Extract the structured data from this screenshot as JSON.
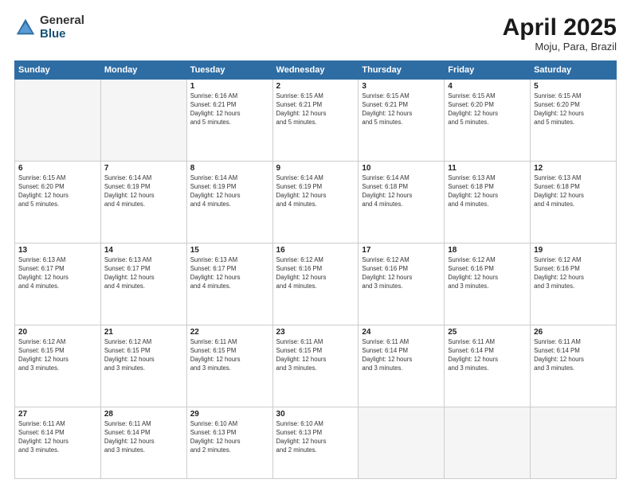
{
  "header": {
    "logo_general": "General",
    "logo_blue": "Blue",
    "title": "April 2025",
    "location": "Moju, Para, Brazil"
  },
  "days_of_week": [
    "Sunday",
    "Monday",
    "Tuesday",
    "Wednesday",
    "Thursday",
    "Friday",
    "Saturday"
  ],
  "weeks": [
    [
      {
        "num": "",
        "info": ""
      },
      {
        "num": "",
        "info": ""
      },
      {
        "num": "1",
        "info": "Sunrise: 6:16 AM\nSunset: 6:21 PM\nDaylight: 12 hours\nand 5 minutes."
      },
      {
        "num": "2",
        "info": "Sunrise: 6:15 AM\nSunset: 6:21 PM\nDaylight: 12 hours\nand 5 minutes."
      },
      {
        "num": "3",
        "info": "Sunrise: 6:15 AM\nSunset: 6:21 PM\nDaylight: 12 hours\nand 5 minutes."
      },
      {
        "num": "4",
        "info": "Sunrise: 6:15 AM\nSunset: 6:20 PM\nDaylight: 12 hours\nand 5 minutes."
      },
      {
        "num": "5",
        "info": "Sunrise: 6:15 AM\nSunset: 6:20 PM\nDaylight: 12 hours\nand 5 minutes."
      }
    ],
    [
      {
        "num": "6",
        "info": "Sunrise: 6:15 AM\nSunset: 6:20 PM\nDaylight: 12 hours\nand 5 minutes."
      },
      {
        "num": "7",
        "info": "Sunrise: 6:14 AM\nSunset: 6:19 PM\nDaylight: 12 hours\nand 4 minutes."
      },
      {
        "num": "8",
        "info": "Sunrise: 6:14 AM\nSunset: 6:19 PM\nDaylight: 12 hours\nand 4 minutes."
      },
      {
        "num": "9",
        "info": "Sunrise: 6:14 AM\nSunset: 6:19 PM\nDaylight: 12 hours\nand 4 minutes."
      },
      {
        "num": "10",
        "info": "Sunrise: 6:14 AM\nSunset: 6:18 PM\nDaylight: 12 hours\nand 4 minutes."
      },
      {
        "num": "11",
        "info": "Sunrise: 6:13 AM\nSunset: 6:18 PM\nDaylight: 12 hours\nand 4 minutes."
      },
      {
        "num": "12",
        "info": "Sunrise: 6:13 AM\nSunset: 6:18 PM\nDaylight: 12 hours\nand 4 minutes."
      }
    ],
    [
      {
        "num": "13",
        "info": "Sunrise: 6:13 AM\nSunset: 6:17 PM\nDaylight: 12 hours\nand 4 minutes."
      },
      {
        "num": "14",
        "info": "Sunrise: 6:13 AM\nSunset: 6:17 PM\nDaylight: 12 hours\nand 4 minutes."
      },
      {
        "num": "15",
        "info": "Sunrise: 6:13 AM\nSunset: 6:17 PM\nDaylight: 12 hours\nand 4 minutes."
      },
      {
        "num": "16",
        "info": "Sunrise: 6:12 AM\nSunset: 6:16 PM\nDaylight: 12 hours\nand 4 minutes."
      },
      {
        "num": "17",
        "info": "Sunrise: 6:12 AM\nSunset: 6:16 PM\nDaylight: 12 hours\nand 3 minutes."
      },
      {
        "num": "18",
        "info": "Sunrise: 6:12 AM\nSunset: 6:16 PM\nDaylight: 12 hours\nand 3 minutes."
      },
      {
        "num": "19",
        "info": "Sunrise: 6:12 AM\nSunset: 6:16 PM\nDaylight: 12 hours\nand 3 minutes."
      }
    ],
    [
      {
        "num": "20",
        "info": "Sunrise: 6:12 AM\nSunset: 6:15 PM\nDaylight: 12 hours\nand 3 minutes."
      },
      {
        "num": "21",
        "info": "Sunrise: 6:12 AM\nSunset: 6:15 PM\nDaylight: 12 hours\nand 3 minutes."
      },
      {
        "num": "22",
        "info": "Sunrise: 6:11 AM\nSunset: 6:15 PM\nDaylight: 12 hours\nand 3 minutes."
      },
      {
        "num": "23",
        "info": "Sunrise: 6:11 AM\nSunset: 6:15 PM\nDaylight: 12 hours\nand 3 minutes."
      },
      {
        "num": "24",
        "info": "Sunrise: 6:11 AM\nSunset: 6:14 PM\nDaylight: 12 hours\nand 3 minutes."
      },
      {
        "num": "25",
        "info": "Sunrise: 6:11 AM\nSunset: 6:14 PM\nDaylight: 12 hours\nand 3 minutes."
      },
      {
        "num": "26",
        "info": "Sunrise: 6:11 AM\nSunset: 6:14 PM\nDaylight: 12 hours\nand 3 minutes."
      }
    ],
    [
      {
        "num": "27",
        "info": "Sunrise: 6:11 AM\nSunset: 6:14 PM\nDaylight: 12 hours\nand 3 minutes."
      },
      {
        "num": "28",
        "info": "Sunrise: 6:11 AM\nSunset: 6:14 PM\nDaylight: 12 hours\nand 3 minutes."
      },
      {
        "num": "29",
        "info": "Sunrise: 6:10 AM\nSunset: 6:13 PM\nDaylight: 12 hours\nand 2 minutes."
      },
      {
        "num": "30",
        "info": "Sunrise: 6:10 AM\nSunset: 6:13 PM\nDaylight: 12 hours\nand 2 minutes."
      },
      {
        "num": "",
        "info": ""
      },
      {
        "num": "",
        "info": ""
      },
      {
        "num": "",
        "info": ""
      }
    ]
  ]
}
